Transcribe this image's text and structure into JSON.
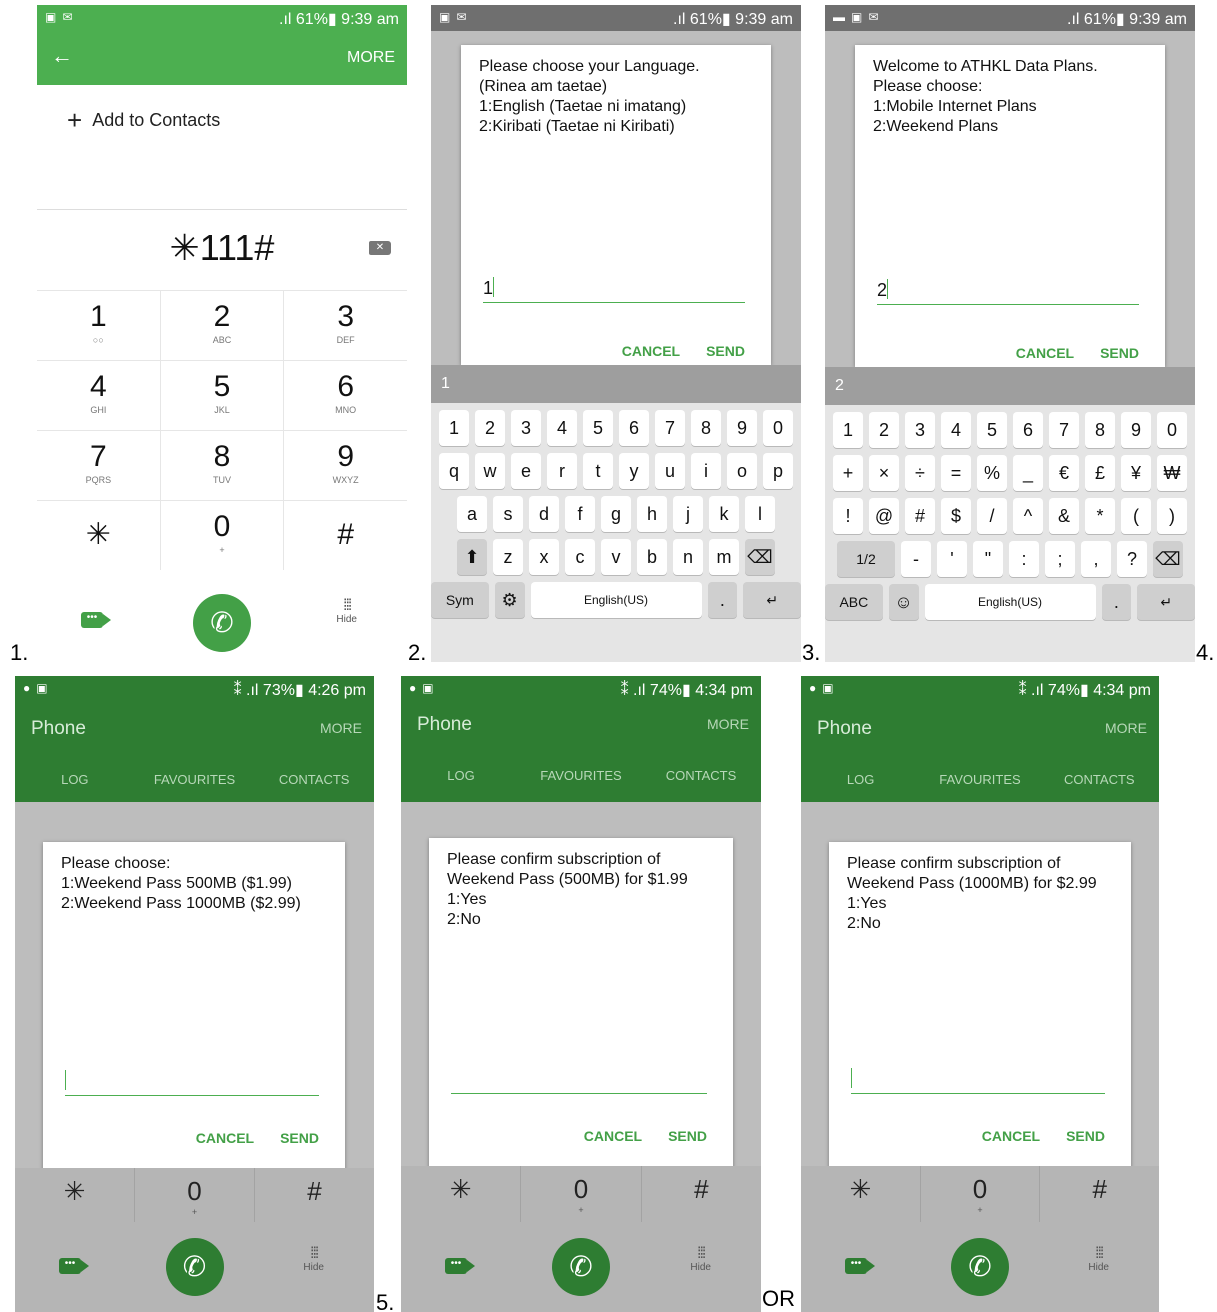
{
  "labels": {
    "n1": "1.",
    "n2": "2.",
    "n3": "3.",
    "n4": "4.",
    "n5": "5.",
    "or": "OR"
  },
  "status_am": {
    "right": ".ıl 61%▮ 9:39 am"
  },
  "status_pm": [
    "⁑ .ıl 73%▮ 4:26 pm",
    "⁑ .ıl 74%▮ 4:34 pm",
    "⁑ .ıl 74%▮ 4:34 pm"
  ],
  "dialer": {
    "back": "←",
    "more": "MORE",
    "add_contacts": "Add to Contacts",
    "number": "✳111#",
    "keys": [
      [
        {
          "d": "1",
          "s": "○○"
        },
        {
          "d": "2",
          "s": "ABC"
        },
        {
          "d": "3",
          "s": "DEF"
        }
      ],
      [
        {
          "d": "4",
          "s": "GHI"
        },
        {
          "d": "5",
          "s": "JKL"
        },
        {
          "d": "6",
          "s": "MNO"
        }
      ],
      [
        {
          "d": "7",
          "s": "PQRS"
        },
        {
          "d": "8",
          "s": "TUV"
        },
        {
          "d": "9",
          "s": "WXYZ"
        }
      ],
      [
        {
          "d": "✳",
          "s": ""
        },
        {
          "d": "0",
          "s": "+"
        },
        {
          "d": "#",
          "s": ""
        }
      ]
    ],
    "hide": "Hide"
  },
  "ussd": [
    {
      "text": "Please choose your Language.\n(Rinea am taetae)\n1:English (Taetae ni imatang)\n2:Kiribati (Taetae ni Kiribati)",
      "value": "1"
    },
    {
      "text": "Welcome to ATHKL Data Plans.\nPlease choose:\n1:Mobile Internet Plans\n2:Weekend Plans",
      "value": "2"
    },
    {
      "text": "Please choose:\n1:Weekend Pass 500MB ($1.99)\n2:Weekend Pass 1000MB ($2.99)",
      "value": ""
    },
    {
      "text": "Please confirm subscription of\nWeekend Pass (500MB)  for $1.99\n1:Yes\n2:No",
      "value": ""
    },
    {
      "text": "Please confirm subscription of\nWeekend Pass (1000MB)  for $2.99\n1:Yes\n2:No",
      "value": ""
    }
  ],
  "buttons": {
    "cancel": "CANCEL",
    "send": "SEND"
  },
  "keyboard_alpha": {
    "strip": "1",
    "rows": [
      [
        "1",
        "2",
        "3",
        "4",
        "5",
        "6",
        "7",
        "8",
        "9",
        "0"
      ],
      [
        "q",
        "w",
        "e",
        "r",
        "t",
        "y",
        "u",
        "i",
        "o",
        "p"
      ],
      [
        "a",
        "s",
        "d",
        "f",
        "g",
        "h",
        "j",
        "k",
        "l"
      ],
      [
        "⬆",
        "z",
        "x",
        "c",
        "v",
        "b",
        "n",
        "m",
        "⌫"
      ]
    ],
    "mode": "Sym",
    "space": "English(US)"
  },
  "keyboard_sym": {
    "strip": "2",
    "rows": [
      [
        "1",
        "2",
        "3",
        "4",
        "5",
        "6",
        "7",
        "8",
        "9",
        "0"
      ],
      [
        "+",
        "×",
        "÷",
        "=",
        "%",
        "_",
        "€",
        "£",
        "¥",
        "₩"
      ],
      [
        "!",
        "@",
        "#",
        "$",
        "/",
        "^",
        "&",
        "*",
        "(",
        ")"
      ],
      [
        "1/2",
        "-",
        "'",
        "\"",
        ":",
        ";",
        ",",
        "?",
        "⌫"
      ]
    ],
    "mode": "ABC",
    "space": "English(US)"
  },
  "phone_app": {
    "title": "Phone",
    "more": "MORE",
    "tabs": [
      "LOG",
      "FAVOURITES",
      "CONTACTS"
    ]
  },
  "low_keys": [
    {
      "d": "✳",
      "s": ""
    },
    {
      "d": "0",
      "s": "+"
    },
    {
      "d": "#",
      "s": ""
    }
  ]
}
